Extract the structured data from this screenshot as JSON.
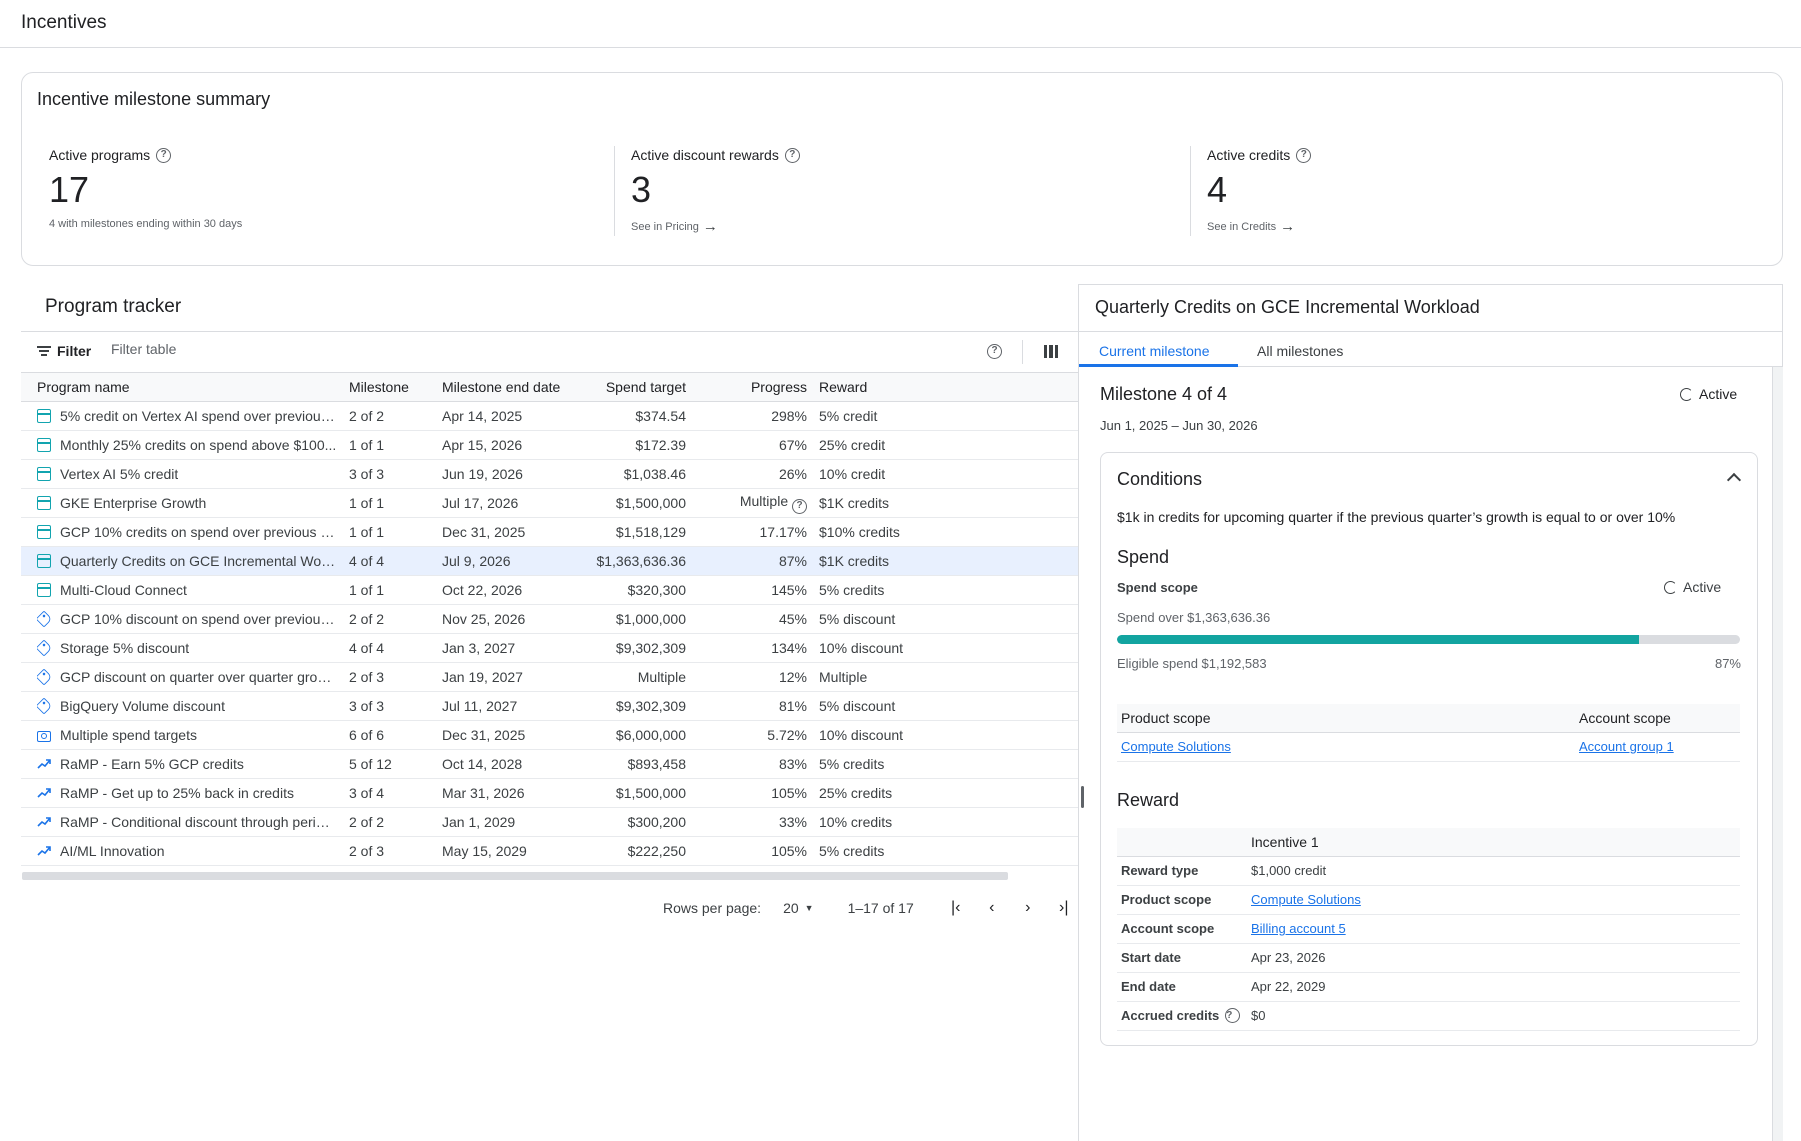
{
  "header": {
    "title": "Incentives"
  },
  "summary": {
    "title": "Incentive milestone summary",
    "active_programs": {
      "label": "Active programs",
      "value": "17",
      "note": "4 with milestones ending within 30 days"
    },
    "active_discounts": {
      "label": "Active discount rewards",
      "value": "3",
      "link": "See in Pricing"
    },
    "active_credits": {
      "label": "Active credits",
      "value": "4",
      "link": "See in Credits"
    }
  },
  "tracker": {
    "title": "Program tracker",
    "filter_label": "Filter",
    "filter_placeholder": "Filter table",
    "columns": {
      "name": "Program name",
      "milestone": "Milestone",
      "end": "Milestone end date",
      "target": "Spend target",
      "progress": "Progress",
      "reward": "Reward"
    },
    "rows": [
      {
        "icon": "gift-icon",
        "name": "5% credit on Vertex AI spend over previous...",
        "milestone": "2 of 2",
        "end": "Apr 14, 2025",
        "target": "$374.54",
        "progress": "298%",
        "reward": "5% credit"
      },
      {
        "icon": "gift-icon",
        "name": "Monthly 25% credits on spend above $100...",
        "milestone": "1 of 1",
        "end": "Apr 15, 2026",
        "target": "$172.39",
        "progress": "67%",
        "reward": "25% credit"
      },
      {
        "icon": "gift-icon",
        "name": "Vertex AI 5% credit",
        "milestone": "3 of 3",
        "end": "Jun 19, 2026",
        "target": "$1,038.46",
        "progress": "26%",
        "reward": "10% credit"
      },
      {
        "icon": "gift-icon",
        "name": "GKE Enterprise Growth",
        "milestone": "1 of 1",
        "end": "Jul 17, 2026",
        "target": "$1,500,000",
        "progress": "Multiple",
        "reward": "$1K credits"
      },
      {
        "icon": "gift-icon",
        "name": "GCP 10% credits on spend over previous qua...",
        "milestone": "1 of 1",
        "end": "Dec 31, 2025",
        "target": "$1,518,129",
        "progress": "17.17%",
        "reward": "$10% credits"
      },
      {
        "icon": "gift-icon",
        "name": "Quarterly Credits on GCE Incremental Workl...",
        "milestone": "4 of 4",
        "end": "Jul 9, 2026",
        "target": "$1,363,636.36",
        "progress": "87%",
        "reward": "$1K credits"
      },
      {
        "icon": "gift-icon",
        "name": "Multi-Cloud Connect",
        "milestone": "1 of 1",
        "end": "Oct 22, 2026",
        "target": "$320,300",
        "progress": "145%",
        "reward": "5% credits"
      },
      {
        "icon": "tag-icon",
        "name": "GCP 10% discount on spend over previous q...",
        "milestone": "2 of 2",
        "end": "Nov 25, 2026",
        "target": "$1,000,000",
        "progress": "45%",
        "reward": "5% discount"
      },
      {
        "icon": "tag-icon",
        "name": " Storage 5% discount",
        "milestone": "4 of 4",
        "end": "Jan 3, 2027",
        "target": "$9,302,309",
        "progress": "134%",
        "reward": "10% discount"
      },
      {
        "icon": "tag-icon",
        "name": "GCP discount on quarter over quarter growth",
        "milestone": "2 of 3",
        "end": "Jan 19, 2027",
        "target": "Multiple",
        "progress": "12%",
        "reward": "Multiple"
      },
      {
        "icon": "tag-icon",
        "name": "BigQuery Volume discount",
        "milestone": "3 of 3",
        "end": "Jul 11, 2027",
        "target": "$9,302,309",
        "progress": "81%",
        "reward": "5% discount"
      },
      {
        "icon": "money-icon",
        "name": "Multiple spend targets",
        "milestone": "6 of 6",
        "end": "Dec 31, 2025",
        "target": "$6,000,000",
        "progress": "5.72%",
        "reward": "10% discount"
      },
      {
        "icon": "trend-icon",
        "name": "RaMP - Earn 5% GCP credits",
        "milestone": "5 of 12",
        "end": "Oct 14, 2028",
        "target": "$893,458",
        "progress": "83%",
        "reward": "5% credits"
      },
      {
        "icon": "trend-icon",
        "name": "RaMP - Get up to 25% back in credits",
        "milestone": "3 of 4",
        "end": "Mar 31, 2026",
        "target": "$1,500,000",
        "progress": "105%",
        "reward": "25% credits"
      },
      {
        "icon": "trend-icon",
        "name": "RaMP - Conditional discount through period...",
        "milestone": "2 of 2",
        "end": "Jan 1, 2029",
        "target": "$300,200",
        "progress": "33%",
        "reward": "10% credits"
      },
      {
        "icon": "trend-icon",
        "name": "AI/ML Innovation",
        "milestone": " 2 of 3",
        "end": "May 15, 2029",
        "target": "$222,250",
        "progress": "105%",
        "reward": "5% credits"
      }
    ],
    "pager": {
      "rows_label": "Rows per page:",
      "rows_value": "20",
      "range": "1–17 of 17"
    }
  },
  "detail": {
    "title": "Quarterly Credits on GCE Incremental Workload",
    "tabs": [
      "Current milestone",
      "All milestones"
    ],
    "milestone_title": "Milestone 4 of 4",
    "milestone_dates": "Jun 1, 2025 – Jun 30, 2026",
    "status": "Active",
    "conditions": {
      "title": "Conditions",
      "text": "$1k in credits for upcoming quarter if the previous quarter’s growth is equal to or over 10%"
    },
    "spend": {
      "title": "Spend",
      "scope_label": "Spend scope",
      "status": "Active",
      "over_label": "Spend  over $1,363,636.36",
      "eligible_label": "Eligible spend  $1,192,583",
      "percent_label": "87%",
      "progress_fraction": 0.838,
      "product_scope_header": "Product scope",
      "account_scope_header": "Account scope",
      "product_scope": "Compute Solutions",
      "account_scope": "Account group 1"
    },
    "reward": {
      "title": "Reward",
      "column": "Incentive 1",
      "rows": [
        {
          "k": "Reward type",
          "v": "$1,000 credit",
          "link": false
        },
        {
          "k": "Product scope",
          "v": "Compute Solutions",
          "link": true
        },
        {
          "k": "Account scope",
          "v": "Billing account 5",
          "link": true
        },
        {
          "k": "Start date",
          "v": "Apr 23, 2026",
          "link": false
        },
        {
          "k": "End date",
          "v": "Apr 22, 2029",
          "link": false
        },
        {
          "k": "Accrued credits",
          "v": "$0",
          "link": false,
          "help": true
        }
      ]
    }
  },
  "colors": {
    "accent": "#1a73e8",
    "teal": "#12a4af",
    "selected_row": "#e8f0fe"
  }
}
